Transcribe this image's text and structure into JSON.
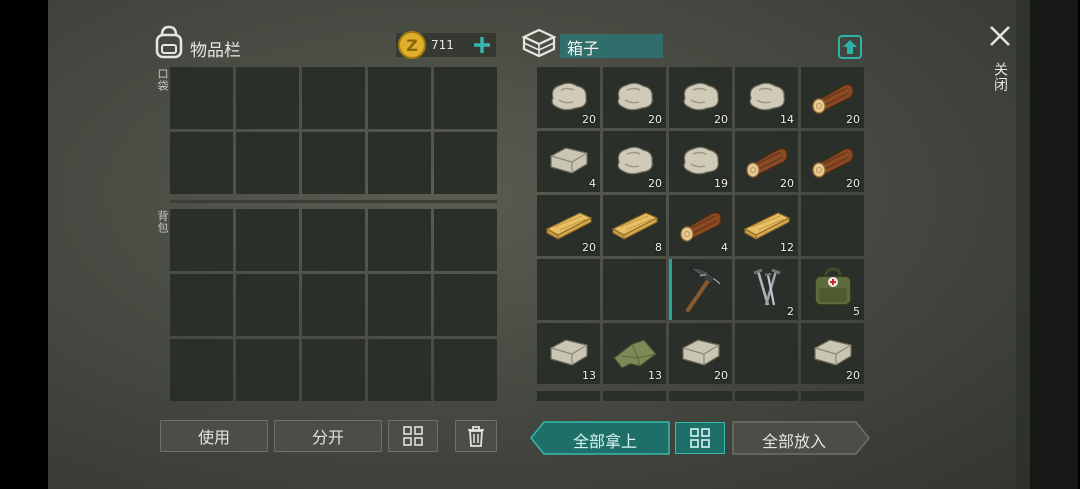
{
  "inventory": {
    "title": "物品栏",
    "coins": "711",
    "pocket_label": "口袋",
    "backpack_label": "背包"
  },
  "container": {
    "name": "箱子"
  },
  "close_label": "关闭",
  "buttons": {
    "use": "使用",
    "split": "分开",
    "take_all": "全部拿上",
    "put_all": "全部放入"
  },
  "box_items": [
    {
      "icon": "stone-icon",
      "count": "20"
    },
    {
      "icon": "stone-icon",
      "count": "20"
    },
    {
      "icon": "stone-icon",
      "count": "20"
    },
    {
      "icon": "stone-icon",
      "count": "14"
    },
    {
      "icon": "log-icon",
      "count": "20"
    },
    {
      "icon": "limestone-icon",
      "count": "4"
    },
    {
      "icon": "stone-icon",
      "count": "20"
    },
    {
      "icon": "stone-icon",
      "count": "19"
    },
    {
      "icon": "log-icon",
      "count": "20"
    },
    {
      "icon": "log-icon",
      "count": "20"
    },
    {
      "icon": "plank-icon",
      "count": "20"
    },
    {
      "icon": "plank-icon",
      "count": "8"
    },
    {
      "icon": "log-icon",
      "count": "4"
    },
    {
      "icon": "plank-icon",
      "count": "12"
    },
    {
      "icon": "",
      "count": ""
    },
    {
      "icon": "",
      "count": ""
    },
    {
      "icon": "",
      "count": ""
    },
    {
      "icon": "pickaxe-icon",
      "count": ""
    },
    {
      "icon": "nails-icon",
      "count": "2"
    },
    {
      "icon": "medkit-bag-icon",
      "count": "5"
    },
    {
      "icon": "limestone-icon",
      "count": "13"
    },
    {
      "icon": "cloth-icon",
      "count": "13"
    },
    {
      "icon": "limestone-icon",
      "count": "20"
    },
    {
      "icon": "",
      "count": ""
    },
    {
      "icon": "limestone-icon",
      "count": "20"
    }
  ],
  "colors": {
    "accent_teal": "#2aa39a",
    "coin_gold": "#e0b02a"
  }
}
